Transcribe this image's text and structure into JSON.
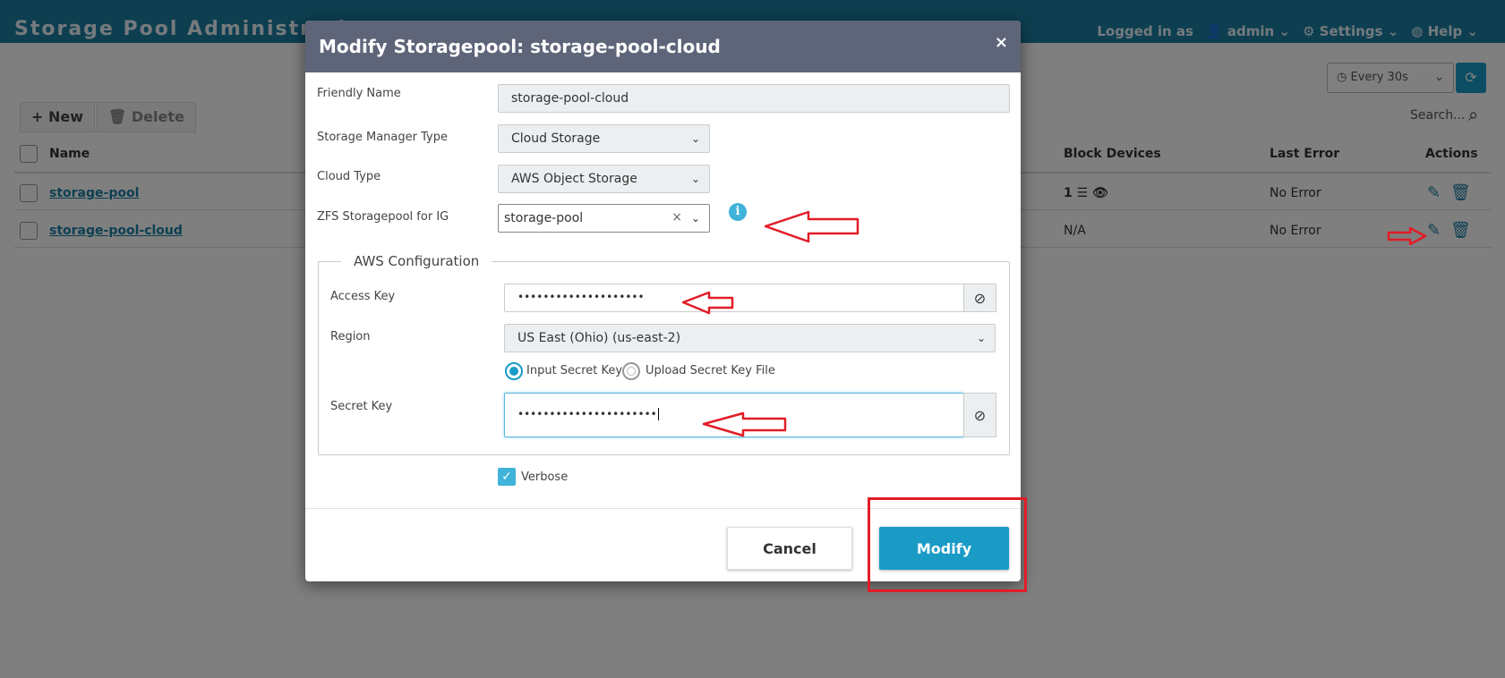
{
  "app": {
    "title": "Storage Pool Administrati",
    "logged_in_prefix": "Logged in as",
    "user": "admin",
    "settings_label": "Settings",
    "help_label": "Help",
    "refresh_interval": "Every 30s",
    "new_label": "New",
    "delete_label": "Delete",
    "search_placeholder": "Search..."
  },
  "table": {
    "columns": {
      "name": "Name",
      "block_devices": "Block Devices",
      "last_error": "Last Error",
      "actions": "Actions"
    },
    "rows": [
      {
        "name": "storage-pool",
        "block_devices": "1",
        "last_error": "No Error"
      },
      {
        "name": "storage-pool-cloud",
        "block_devices": "N/A",
        "last_error": "No Error"
      }
    ]
  },
  "modal": {
    "title": "Modify Storagepool: storage-pool-cloud",
    "close_glyph": "×",
    "friendly_name": {
      "label": "Friendly Name",
      "value": "storage-pool-cloud"
    },
    "manager_type": {
      "label": "Storage Manager Type",
      "value": "Cloud Storage"
    },
    "cloud_type": {
      "label": "Cloud Type",
      "value": "AWS Object Storage"
    },
    "zfs_pool": {
      "label": "ZFS Storagepool for IG",
      "value": "storage-pool"
    },
    "aws": {
      "legend": "AWS Configuration",
      "access_key": {
        "label": "Access Key",
        "value": "••••••••••••••••••••"
      },
      "region": {
        "label": "Region",
        "value": "US East (Ohio) (us-east-2)"
      },
      "radio_input": "Input Secret Key",
      "radio_upload": "Upload Secret Key File",
      "secret_key": {
        "label": "Secret Key",
        "value": "••••••••••••••••••••••"
      }
    },
    "verbose_label": "Verbose",
    "cancel_label": "Cancel",
    "modify_label": "Modify"
  },
  "colors": {
    "header": "#1a7fa3",
    "accent": "#1a9bc6",
    "modal_header": "#5e6579",
    "annotation": "#e11d26"
  }
}
